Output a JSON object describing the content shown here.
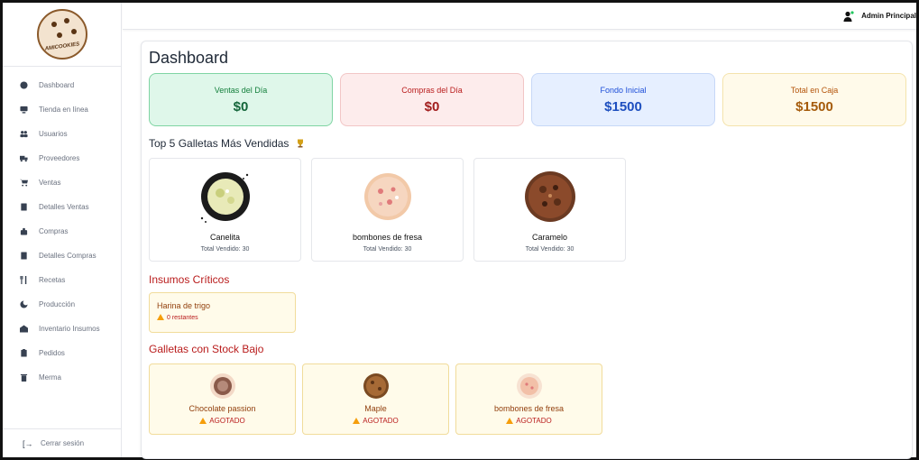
{
  "brand": {
    "logo_text": "AMICOOKIES"
  },
  "sidebar": {
    "items": [
      {
        "label": "Dashboard",
        "icon": "palette-icon"
      },
      {
        "label": "Tienda en línea",
        "icon": "monitor-icon"
      },
      {
        "label": "Usuarios",
        "icon": "users-icon"
      },
      {
        "label": "Proveedores",
        "icon": "truck-icon"
      },
      {
        "label": "Ventas",
        "icon": "cart-icon"
      },
      {
        "label": "Detalles Ventas",
        "icon": "book-icon"
      },
      {
        "label": "Compras",
        "icon": "bag-icon"
      },
      {
        "label": "Detalles Compras",
        "icon": "book-icon"
      },
      {
        "label": "Recetas",
        "icon": "utensils-icon"
      },
      {
        "label": "Producción",
        "icon": "cookie-icon"
      },
      {
        "label": "Inventario Insumos",
        "icon": "warehouse-icon"
      },
      {
        "label": "Pedidos",
        "icon": "clipboard-icon"
      },
      {
        "label": "Merma",
        "icon": "trash-icon"
      }
    ],
    "logout": "Cerrar sesión"
  },
  "topbar": {
    "user": "Admin Principal"
  },
  "main": {
    "title": "Dashboard",
    "stats": [
      {
        "label": "Ventas del Día",
        "value": "$0",
        "color": "#dff7ea"
      },
      {
        "label": "Compras del Día",
        "value": "$0",
        "color": "#fdecec"
      },
      {
        "label": "Fondo Inicial",
        "value": "$1500",
        "color": "#e6efff"
      },
      {
        "label": "Total en Caja",
        "value": "$1500",
        "color": "#fffaea"
      }
    ],
    "top_title": "Top 5 Galletas Más Vendidas",
    "top": [
      {
        "name": "Canelita",
        "sold": "Total Vendido: 30"
      },
      {
        "name": "bombones de fresa",
        "sold": "Total Vendido: 30"
      },
      {
        "name": "Caramelo",
        "sold": "Total Vendido: 30"
      }
    ],
    "insumos_title": "Insumos Críticos",
    "insumos": [
      {
        "name": "Harina de trigo",
        "remaining": "0 restantes"
      }
    ],
    "stock_title": "Galletas con Stock Bajo",
    "stock": [
      {
        "name": "Chocolate passion",
        "status": "AGOTADO"
      },
      {
        "name": "Maple",
        "status": "AGOTADO"
      },
      {
        "name": "bombones de fresa",
        "status": "AGOTADO"
      }
    ]
  }
}
